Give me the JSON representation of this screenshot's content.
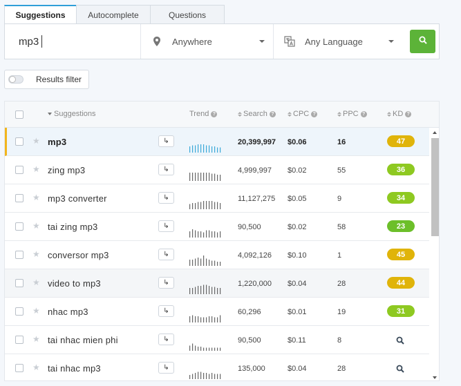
{
  "tabs": [
    {
      "label": "Suggestions",
      "active": true
    },
    {
      "label": "Autocomplete",
      "active": false
    },
    {
      "label": "Questions",
      "active": false
    }
  ],
  "search": {
    "keyword": "mp3",
    "location": "Anywhere",
    "language": "Any Language"
  },
  "filter": {
    "label": "Results filter",
    "enabled": false
  },
  "table": {
    "headers": {
      "suggestions": "Suggestions",
      "trend": "Trend",
      "search": "Search",
      "cpc": "CPC",
      "ppc": "PPC",
      "kd": "KD"
    },
    "rows": [
      {
        "keyword": "mp3",
        "search": "20,399,997",
        "cpc": "$0.06",
        "ppc": "16",
        "kd": "47",
        "kd_color": "#e0b40a",
        "trend": [
          6,
          7,
          7,
          8,
          8,
          8,
          7,
          7,
          6,
          6,
          5,
          5
        ],
        "trend_color": "#39a8d8"
      },
      {
        "keyword": "zing mp3",
        "search": "4,999,997",
        "cpc": "$0.02",
        "ppc": "55",
        "kd": "36",
        "kd_color": "#8ec921",
        "trend": [
          8,
          8,
          8,
          8,
          8,
          8,
          8,
          8,
          7,
          7,
          6,
          6
        ],
        "trend_color": "#666666"
      },
      {
        "keyword": "mp3 converter",
        "search": "11,127,275",
        "cpc": "$0.05",
        "ppc": "9",
        "kd": "34",
        "kd_color": "#8ec921",
        "trend": [
          5,
          6,
          6,
          7,
          7,
          8,
          8,
          8,
          8,
          7,
          7,
          6
        ],
        "trend_color": "#666666"
      },
      {
        "keyword": "tai zing mp3",
        "search": "90,500",
        "cpc": "$0.02",
        "ppc": "58",
        "kd": "23",
        "kd_color": "#6cbf2a",
        "trend": [
          6,
          8,
          7,
          6,
          6,
          5,
          7,
          7,
          6,
          6,
          5,
          6
        ],
        "trend_color": "#666666"
      },
      {
        "keyword": "conversor mp3",
        "search": "4,092,126",
        "cpc": "$0.10",
        "ppc": "1",
        "kd": "45",
        "kd_color": "#e0b40a",
        "trend": [
          6,
          6,
          7,
          8,
          7,
          10,
          7,
          6,
          5,
          5,
          4,
          4
        ],
        "trend_color": "#666666"
      },
      {
        "keyword": "video to mp3",
        "search": "1,220,000",
        "cpc": "$0.04",
        "ppc": "28",
        "kd": "44",
        "kd_color": "#e0b40a",
        "trend": [
          6,
          6,
          7,
          8,
          8,
          9,
          9,
          8,
          7,
          7,
          6,
          6
        ],
        "trend_color": "#666666"
      },
      {
        "keyword": "nhac mp3",
        "search": "60,296",
        "cpc": "$0.01",
        "ppc": "19",
        "kd": "31",
        "kd_color": "#8ec921",
        "trend": [
          6,
          7,
          6,
          6,
          5,
          5,
          5,
          6,
          6,
          5,
          5,
          7
        ],
        "trend_color": "#666666"
      },
      {
        "keyword": "tai nhac mien phi",
        "search": "90,500",
        "cpc": "$0.11",
        "ppc": "8",
        "kd": "",
        "kd_color": "",
        "trend": [
          5,
          7,
          5,
          4,
          4,
          3,
          3,
          3,
          3,
          3,
          3,
          3
        ],
        "trend_color": "#666666"
      },
      {
        "keyword": "tai nhac mp3",
        "search": "135,000",
        "cpc": "$0.04",
        "ppc": "28",
        "kd": "",
        "kd_color": "",
        "trend": [
          4,
          5,
          6,
          7,
          7,
          6,
          6,
          5,
          6,
          5,
          5,
          5
        ],
        "trend_color": "#666666"
      }
    ]
  },
  "colors": {
    "accent": "#2e9fd8",
    "search_button": "#5cb338",
    "selected_marker": "#f2b51c"
  },
  "icons": [
    "map-marker-icon",
    "translate-icon",
    "search-icon",
    "star-icon",
    "arrow-forward-icon",
    "help-icon",
    "sort-icon",
    "chevron-down-icon"
  ]
}
